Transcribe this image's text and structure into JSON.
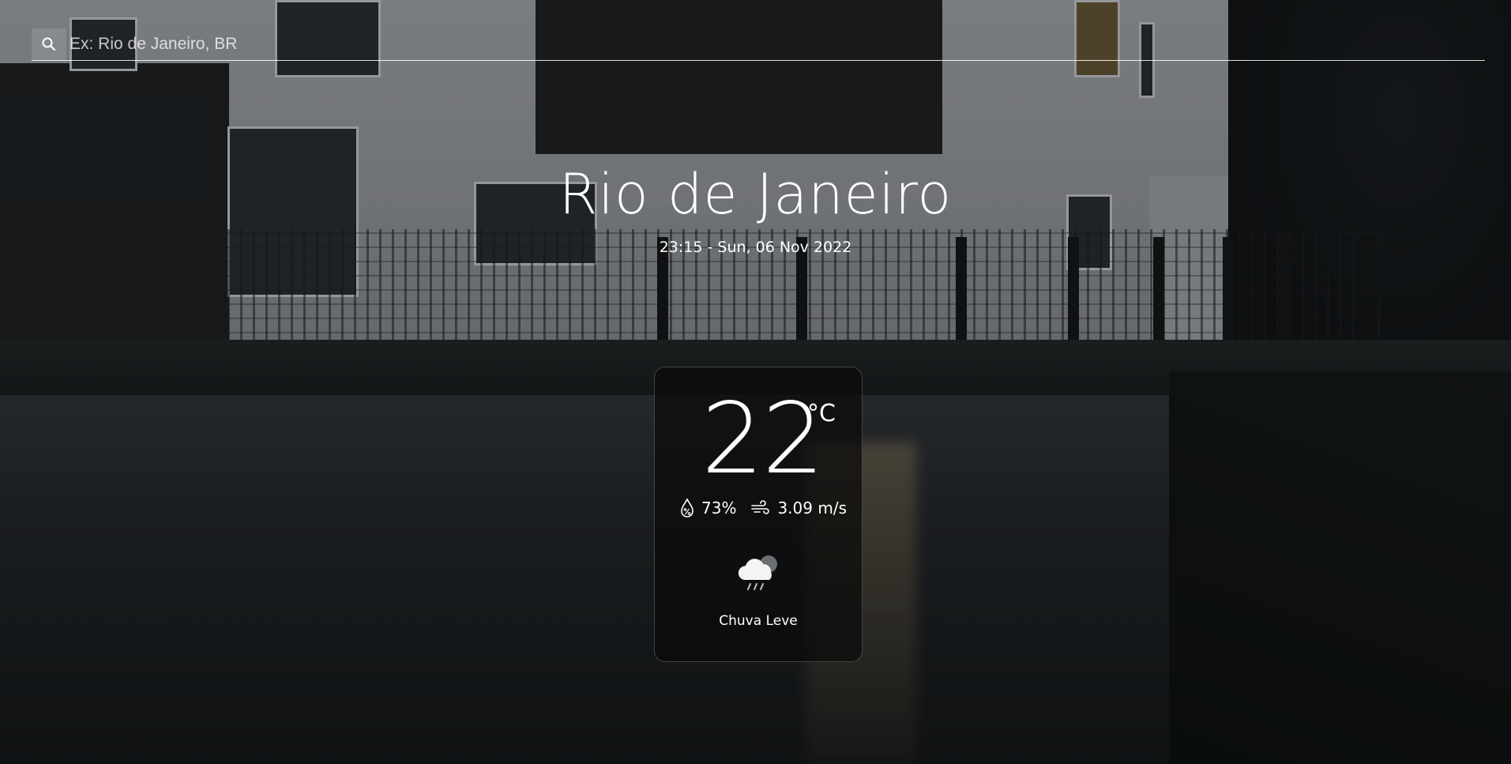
{
  "search": {
    "placeholder": "Ex: Rio de Janeiro, BR",
    "icon": "search-icon"
  },
  "location": {
    "city": "Rio de Janeiro",
    "datetime": "23:15 - Sun, 06 Nov 2022"
  },
  "weather": {
    "temperature": "22",
    "unit": "°C",
    "humidity": "73%",
    "wind": "3.09 m/s",
    "description": "Chuva Leve",
    "icons": {
      "humidity": "humidity-drop-icon",
      "wind": "wind-icon",
      "condition": "rain-cloud-icon"
    }
  },
  "background": {
    "scene": "rainy-street-photo"
  }
}
